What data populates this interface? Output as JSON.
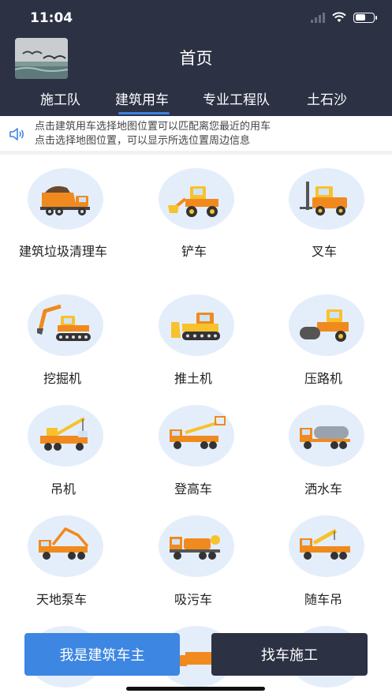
{
  "status_bar": {
    "time": "11:04"
  },
  "header": {
    "title": "首页"
  },
  "tabs": [
    {
      "label": "施工队",
      "active": false
    },
    {
      "label": "建筑用车",
      "active": true
    },
    {
      "label": "专业工程队",
      "active": false
    },
    {
      "label": "土石沙",
      "active": false
    }
  ],
  "notice": {
    "line1": "点击建筑用车选择地图位置可以匹配离您最近的用车",
    "line2": "点击选择地图位置，可以显示所选位置周边信息"
  },
  "vehicles": [
    {
      "label": "建筑垃圾清理车",
      "icon": "dump-truck-icon"
    },
    {
      "label": "铲车",
      "icon": "loader-icon"
    },
    {
      "label": "叉车",
      "icon": "forklift-icon"
    },
    {
      "label": "挖掘机",
      "icon": "excavator-icon"
    },
    {
      "label": "推土机",
      "icon": "bulldozer-icon"
    },
    {
      "label": "压路机",
      "icon": "road-roller-icon"
    },
    {
      "label": "吊机",
      "icon": "crane-icon"
    },
    {
      "label": "登高车",
      "icon": "aerial-platform-truck-icon"
    },
    {
      "label": "洒水车",
      "icon": "water-sprinkler-truck-icon"
    },
    {
      "label": "天地泵车",
      "icon": "concrete-pump-truck-icon"
    },
    {
      "label": "吸污车",
      "icon": "sewage-suction-truck-icon"
    },
    {
      "label": "随车吊",
      "icon": "truck-mounted-crane-icon"
    }
  ],
  "buttons": {
    "owner": "我是建筑车主",
    "find": "找车施工"
  },
  "colors": {
    "header_bg": "#2c3144",
    "accent": "#3d86e2",
    "icon_bg": "#e4eefb",
    "vehicle_orange": "#f08a1e",
    "vehicle_yellow": "#f7c22b"
  }
}
